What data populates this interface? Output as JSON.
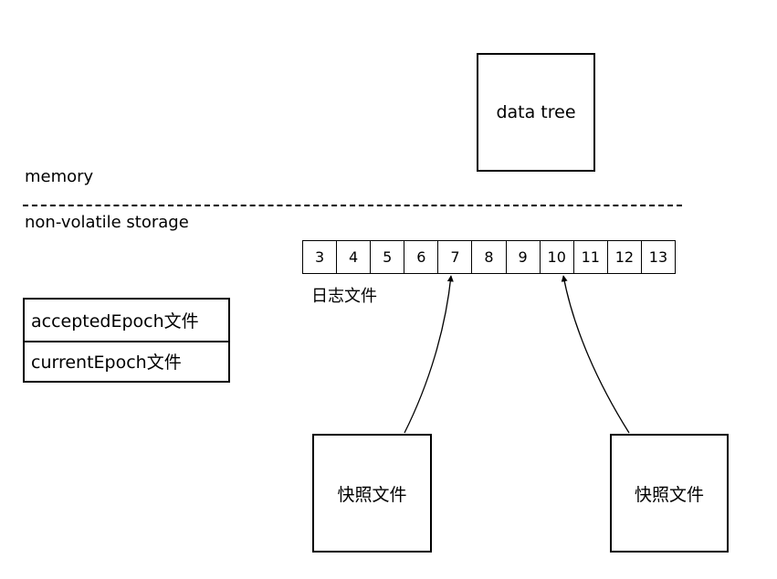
{
  "memory": {
    "label": "memory",
    "data_tree_label": "data tree"
  },
  "storage": {
    "label": "non-volatile storage",
    "log": {
      "entries": [
        "3",
        "4",
        "5",
        "6",
        "7",
        "8",
        "9",
        "10",
        "11",
        "12",
        "13"
      ],
      "label": "日志文件"
    },
    "epoch_files": {
      "accepted_label": "acceptedEpoch文件",
      "current_label": "currentEpoch文件"
    },
    "snapshots": [
      {
        "label": "快照文件",
        "points_to": "7"
      },
      {
        "label": "快照文件",
        "points_to": "10"
      }
    ]
  }
}
